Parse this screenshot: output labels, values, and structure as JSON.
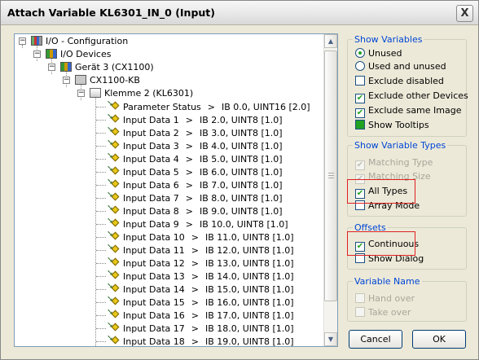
{
  "window": {
    "title": "Attach Variable KL6301_IN_0 (Input)",
    "close_glyph": "X"
  },
  "tree": {
    "root": "I/O - Configuration",
    "devices": "I/O Devices",
    "device": "Gerät 3 (CX1100)",
    "box": "CX1100-KB",
    "terminal": "Klemme 2 (KL6301)",
    "variables": [
      {
        "name": "Parameter Status",
        "sep": ">",
        "addr": "IB 0.0, UINT16 [2.0]"
      },
      {
        "name": "Input Data 1",
        "sep": ">",
        "addr": "IB 2.0, UINT8 [1.0]"
      },
      {
        "name": "Input Data 2",
        "sep": ">",
        "addr": "IB 3.0, UINT8 [1.0]"
      },
      {
        "name": "Input Data 3",
        "sep": ">",
        "addr": "IB 4.0, UINT8 [1.0]"
      },
      {
        "name": "Input Data 4",
        "sep": ">",
        "addr": "IB 5.0, UINT8 [1.0]"
      },
      {
        "name": "Input Data 5",
        "sep": ">",
        "addr": "IB 6.0, UINT8 [1.0]"
      },
      {
        "name": "Input Data 6",
        "sep": ">",
        "addr": "IB 7.0, UINT8 [1.0]"
      },
      {
        "name": "Input Data 7",
        "sep": ">",
        "addr": "IB 8.0, UINT8 [1.0]"
      },
      {
        "name": "Input Data 8",
        "sep": ">",
        "addr": "IB 9.0, UINT8 [1.0]"
      },
      {
        "name": "Input Data 9",
        "sep": ">",
        "addr": "IB 10.0, UINT8 [1.0]"
      },
      {
        "name": "Input Data 10",
        "sep": ">",
        "addr": "IB 11.0, UINT8 [1.0]"
      },
      {
        "name": "Input Data 11",
        "sep": ">",
        "addr": "IB 12.0, UINT8 [1.0]"
      },
      {
        "name": "Input Data 12",
        "sep": ">",
        "addr": "IB 13.0, UINT8 [1.0]"
      },
      {
        "name": "Input Data 13",
        "sep": ">",
        "addr": "IB 14.0, UINT8 [1.0]"
      },
      {
        "name": "Input Data 14",
        "sep": ">",
        "addr": "IB 15.0, UINT8 [1.0]"
      },
      {
        "name": "Input Data 15",
        "sep": ">",
        "addr": "IB 16.0, UINT8 [1.0]"
      },
      {
        "name": "Input Data 16",
        "sep": ">",
        "addr": "IB 17.0, UINT8 [1.0]"
      },
      {
        "name": "Input Data 17",
        "sep": ">",
        "addr": "IB 18.0, UINT8 [1.0]"
      },
      {
        "name": "Input Data 18",
        "sep": ">",
        "addr": "IB 19.0, UINT8 [1.0]"
      }
    ]
  },
  "show_variables": {
    "title": "Show Variables",
    "unused": "Unused",
    "used_and_unused": "Used and unused",
    "exclude_disabled": "Exclude disabled",
    "exclude_other_devices": "Exclude other Devices",
    "exclude_same_image": "Exclude same Image",
    "show_tooltips": "Show Tooltips"
  },
  "show_variable_types": {
    "title": "Show Variable Types",
    "matching_type": "Matching Type",
    "matching_size": "Matching Size",
    "all_types": "All Types",
    "array_mode": "Array Mode"
  },
  "offsets": {
    "title": "Offsets",
    "continuous": "Continuous",
    "show_dialog": "Show Dialog"
  },
  "variable_name": {
    "title": "Variable Name",
    "hand_over": "Hand over",
    "take_over": "Take over"
  },
  "buttons": {
    "cancel": "Cancel",
    "ok": "OK"
  },
  "colors": {
    "group_title": "#0046d5",
    "highlight": "#e02020",
    "check": "#21a121"
  }
}
